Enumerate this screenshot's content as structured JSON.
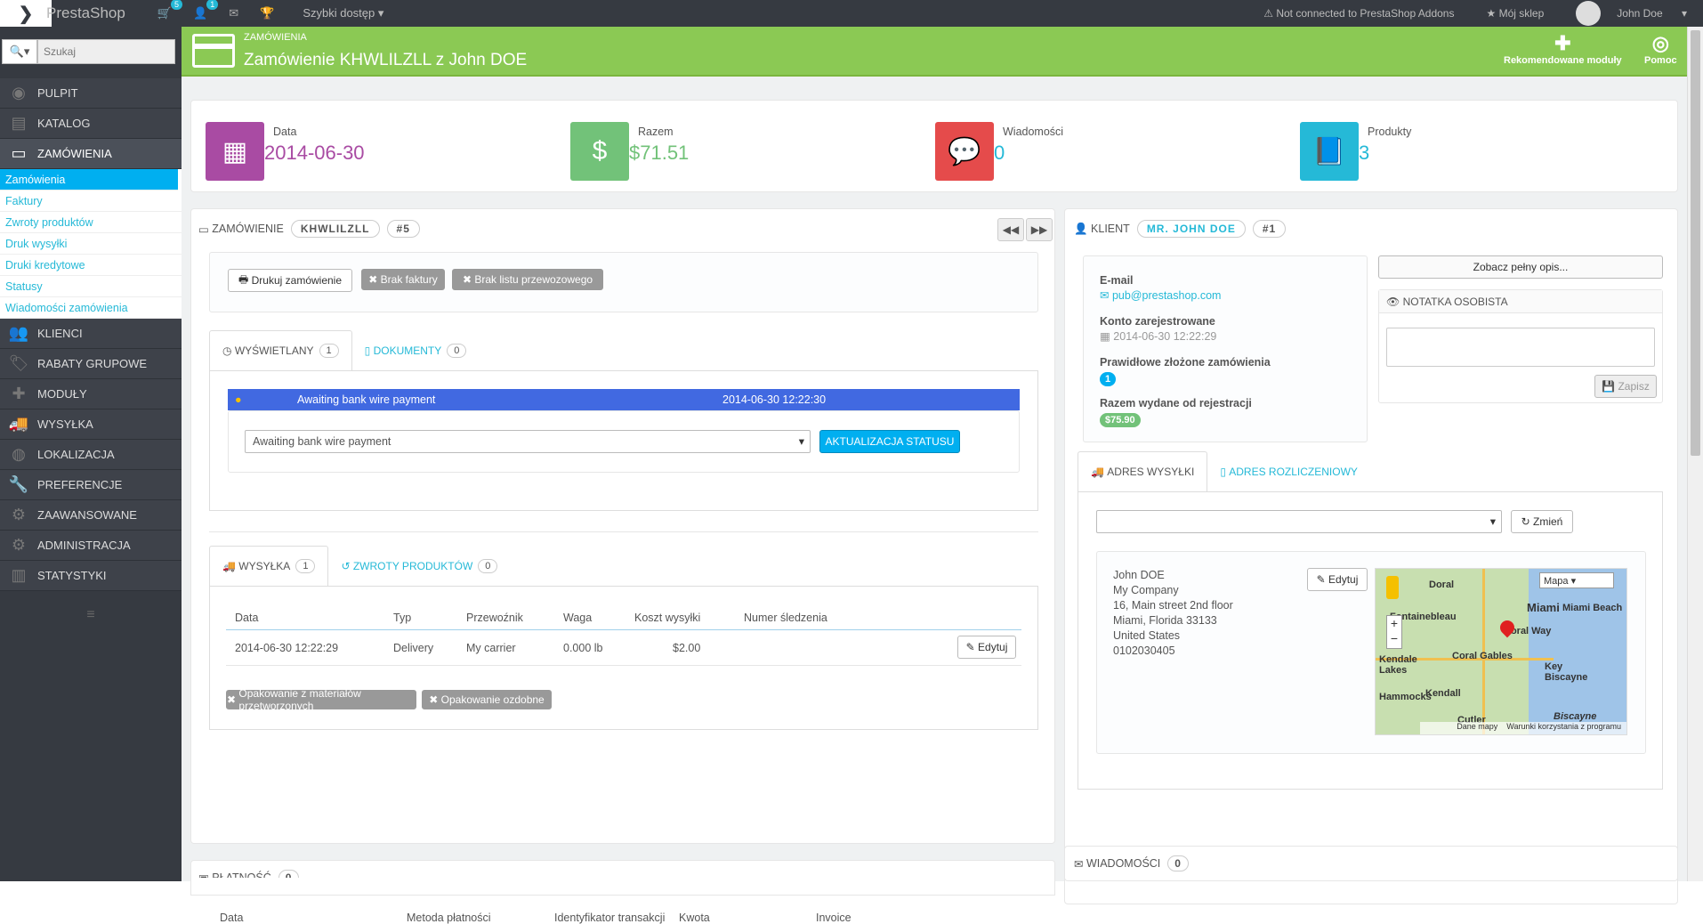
{
  "topbar": {
    "brand": "PrestaShop",
    "cart_badge": "5",
    "user_badge": "1",
    "quick_access": "Szybki dostęp",
    "addons_status": "Not connected to PrestaShop Addons",
    "my_shop": "Mój sklep",
    "user_name": "John Doe"
  },
  "sidebar": {
    "search_placeholder": "Szukaj",
    "items": [
      {
        "label": "PULPIT",
        "icon": "dashboard-icon"
      },
      {
        "label": "KATALOG",
        "icon": "catalog-icon"
      },
      {
        "label": "ZAMÓWIENIA",
        "icon": "orders-icon"
      }
    ],
    "subitems": [
      "Zamówienia",
      "Faktury",
      "Zwroty produktów",
      "Druk wysyłki",
      "Druki kredytowe",
      "Statusy",
      "Wiadomości zamówienia"
    ],
    "items2": [
      {
        "label": "KLIENCI",
        "icon": "customers-icon"
      },
      {
        "label": "RABATY GRUPOWE",
        "icon": "discounts-icon"
      },
      {
        "label": "MODUŁY",
        "icon": "modules-icon"
      },
      {
        "label": "WYSYŁKA",
        "icon": "shipping-icon"
      },
      {
        "label": "LOKALIZACJA",
        "icon": "globe-icon"
      },
      {
        "label": "PREFERENCJE",
        "icon": "wrench-icon"
      },
      {
        "label": "ZAAWANSOWANE",
        "icon": "gears-icon"
      },
      {
        "label": "ADMINISTRACJA",
        "icon": "admin-icon"
      },
      {
        "label": "STATYSTYKI",
        "icon": "stats-icon"
      }
    ]
  },
  "header": {
    "breadcrumb": "ZAMÓWIENIA",
    "title": "Zamówienie KHWLILZLL z John DOE",
    "recommended": "Rekomendowane moduły",
    "help": "Pomoc"
  },
  "kpis": [
    {
      "label": "Data",
      "value": "2014-06-30",
      "color": "#a94ba3"
    },
    {
      "label": "Razem",
      "value": "$71.51",
      "color": "#72c279"
    },
    {
      "label": "Wiadomości",
      "value": "0",
      "color": "#e54b4b"
    },
    {
      "label": "Produkty",
      "value": "3",
      "color": "#25b9d7"
    }
  ],
  "order": {
    "title": "ZAMÓWIENIE",
    "reference": "KHWLILZLL",
    "number": "#5",
    "print_btn": "Drukuj zamówienie",
    "no_invoice": "Brak faktury",
    "no_delivery": "Brak listu przewozowego",
    "tab_status": "WYŚWIETLANY",
    "tab_status_count": "1",
    "tab_docs": "DOKUMENTY",
    "tab_docs_count": "0",
    "status_name": "Awaiting bank wire payment",
    "status_date": "2014-06-30 12:22:30",
    "status_select": "Awaiting bank wire payment",
    "update_btn": "AKTUALIZACJA STATUSU",
    "tab_shipping": "WYSYŁKA",
    "tab_shipping_count": "1",
    "tab_returns": "ZWROTY PRODUKTÓW",
    "tab_returns_count": "0",
    "shipping_headers": [
      "Data",
      "Typ",
      "Przewoźnik",
      "Waga",
      "Koszt wysyłki",
      "Numer śledzenia"
    ],
    "shipping_row": [
      "2014-06-30 12:22:29",
      "Delivery",
      "My carrier",
      "0.000 lb",
      "$2.00"
    ],
    "edit_btn": "Edytuj",
    "recycled": "Opakowanie z materiałów przetworzonych",
    "gift": "Opakowanie ozdobne"
  },
  "payment": {
    "title": "PŁATNOŚĆ",
    "count": "0",
    "headers": [
      "Data",
      "Metoda płatności",
      "Identyfikator transakcji",
      "Kwota",
      "Invoice"
    ]
  },
  "customer": {
    "title": "KLIENT",
    "name": "MR. JOHN DOE",
    "number": "#1",
    "email_label": "E-mail",
    "email": "pub@prestashop.com",
    "registered_label": "Konto zarejestrowane",
    "registered": "2014-06-30 12:22:29",
    "valid_orders_label": "Prawidłowe złożone zamówienia",
    "valid_orders": "1",
    "spent_label": "Razem wydane od rejestracji",
    "spent": "$75.90",
    "full_desc_btn": "Zobacz pełny opis...",
    "note_title": "NOTATKA OSOBISTA",
    "save_btn": "Zapisz"
  },
  "address": {
    "tab_shipping": "ADRES WYSYŁKI",
    "tab_billing": "ADRES ROZLICZENIOWY",
    "change_btn": "Zmień",
    "edit_btn": "Edytuj",
    "lines": [
      "John DOE",
      "My Company",
      "16, Main street 2nd floor",
      "Miami, Florida 33133",
      "United States",
      "0102030405"
    ],
    "map_type": "Mapa",
    "map_labels": [
      "Doral",
      "Miami",
      "Miami Beach",
      "Fontainebleau",
      "Coral Way",
      "Coral Gables",
      "Kendale Lakes",
      "Kendall",
      "Key Biscayne",
      "Biscayne",
      "Cutler",
      "Hammocks"
    ],
    "map_terms": "Dane mapy",
    "map_terms2": "Warunki korzystania z programu"
  },
  "messages": {
    "title": "WIADOMOŚCI",
    "count": "0"
  }
}
